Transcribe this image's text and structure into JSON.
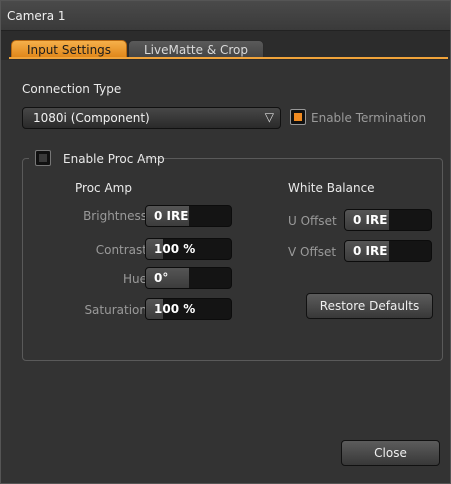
{
  "window": {
    "title": "Camera 1"
  },
  "tabs": [
    {
      "label": "Input Settings",
      "active": true
    },
    {
      "label": "LiveMatte & Crop",
      "active": false
    }
  ],
  "connection": {
    "label": "Connection Type",
    "selected": "1080i (Component)",
    "chevron": "▽",
    "termination": {
      "label": "Enable Termination",
      "checked": true
    }
  },
  "proc_amp": {
    "enable_label": "Enable Proc Amp",
    "enabled": false,
    "heading": "Proc Amp",
    "fields": [
      {
        "label": "Brightness",
        "value": "0 IRE",
        "fill": 0.5
      },
      {
        "label": "Contrast",
        "value": "100 %",
        "fill": 0.2
      },
      {
        "label": "Hue",
        "value": "0°",
        "fill": 0.5
      },
      {
        "label": "Saturation",
        "value": "100 %",
        "fill": 0.2
      }
    ]
  },
  "white_balance": {
    "heading": "White Balance",
    "fields": [
      {
        "label": "U Offset",
        "value": "0 IRE",
        "fill": 0.5
      },
      {
        "label": "V Offset",
        "value": "0 IRE",
        "fill": 0.5
      }
    ],
    "restore_label": "Restore Defaults"
  },
  "footer": {
    "close_label": "Close"
  },
  "colors": {
    "accent": "#f0a33a",
    "panel": "#333333",
    "field": "#141414"
  },
  "icons": {
    "dropdown": "chevron-down-icon"
  }
}
